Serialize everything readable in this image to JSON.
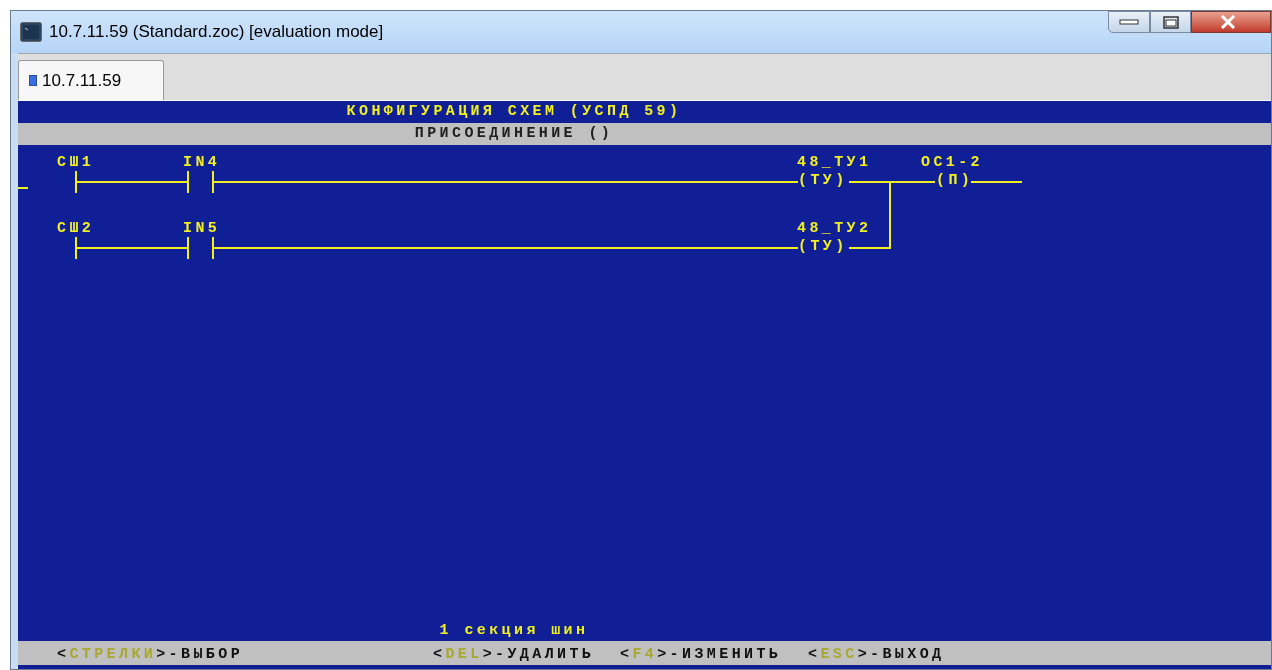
{
  "window": {
    "title": "10.7.11.59 (Standard.zoc) [evaluation mode]"
  },
  "tabs": [
    {
      "label": "10.7.11.59",
      "selected": true
    }
  ],
  "terminal": {
    "title": "КОНФИГУРАЦИЯ СХЕМ (УСПД 59)",
    "subtitle": "ПРИСОЕДИНЕНИЕ ()",
    "rungs": [
      {
        "bus": "СШ1",
        "contact": "IN4",
        "coil_label": "48_ТУ1",
        "coil": "(ТУ)"
      },
      {
        "bus": "СШ2",
        "contact": "IN5",
        "coil_label": "48_ТУ2",
        "coil": "(ТУ)"
      }
    ],
    "output": {
      "label": "ОС1-2",
      "coil": "(П)"
    },
    "section_label": "1 секция шин",
    "hints": [
      {
        "parts": [
          "<",
          "СТРЕЛКИ",
          ">-ВЫБОР"
        ]
      },
      {
        "parts": [
          "<",
          "DEL",
          ">-УДАЛИТЬ"
        ]
      },
      {
        "parts": [
          "<",
          "F4",
          ">-ИЗМЕНИТЬ"
        ]
      },
      {
        "parts": [
          "<",
          "ESC",
          ">-ВЫХОД"
        ]
      }
    ]
  }
}
